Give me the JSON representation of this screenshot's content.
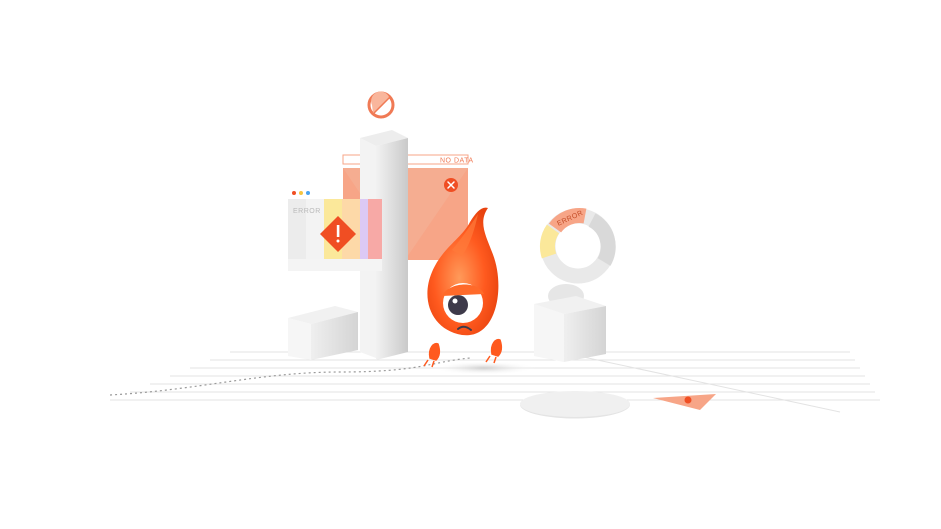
{
  "labels": {
    "no_data": "NO DATA",
    "error": "ERROR",
    "error_ring": "ERROR"
  },
  "colors": {
    "flame": "#ff5a1f",
    "flame_light": "#ff8a4a",
    "panel_orange": "#f7a587",
    "accent_red": "#f04e23",
    "gray_block": "#e2e2e2",
    "stripe_yellow": "#fbe89a",
    "stripe_purple": "#dcc9f5",
    "stripe_pink": "#f7a9a6"
  },
  "icons": [
    "no-entry-icon",
    "close-icon",
    "warning-icon",
    "window-dots-icon"
  ]
}
